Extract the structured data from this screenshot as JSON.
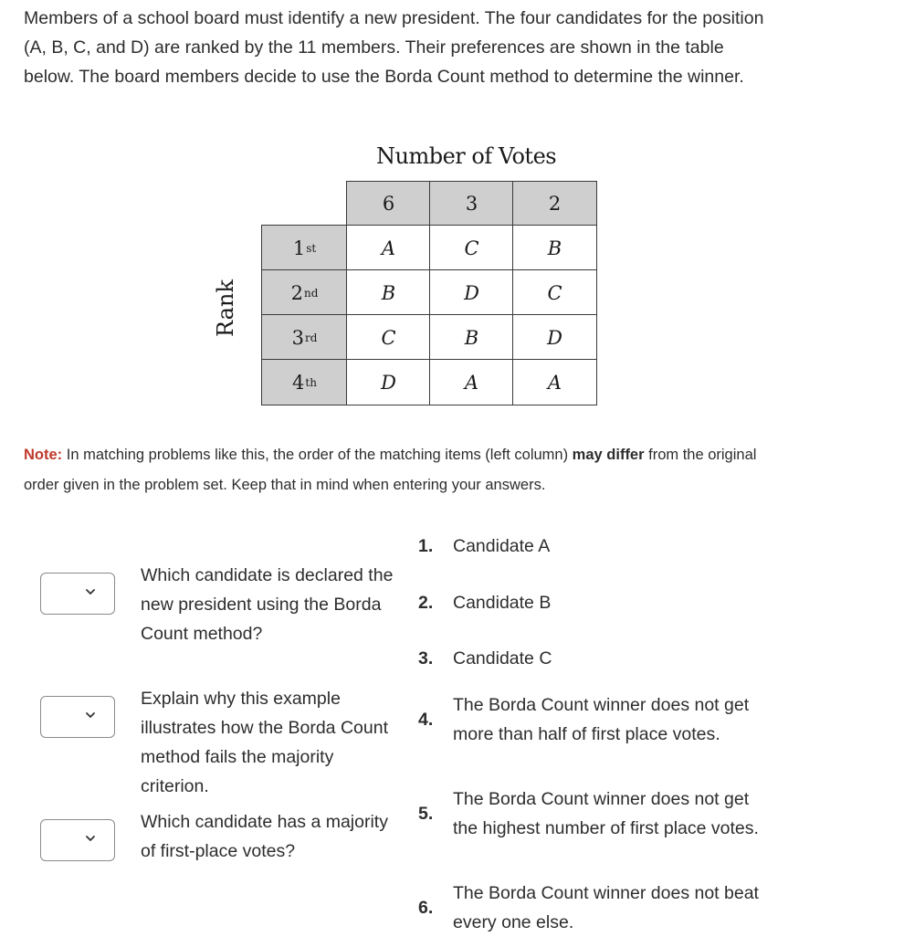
{
  "intro": "Members of a school board must identify a new president. The four candidates for the position (A, B, C, and D) are ranked by the 11 members. Their preferences are shown in the table below. The board members decide to use the Borda Count method to determine the winner.",
  "table": {
    "title": "Number of Votes",
    "rank_label": "Rank",
    "vote_counts": [
      "6",
      "3",
      "2"
    ],
    "ranks": [
      {
        "num": "1",
        "suffix": "st"
      },
      {
        "num": "2",
        "suffix": "nd"
      },
      {
        "num": "3",
        "suffix": "rd"
      },
      {
        "num": "4",
        "suffix": "th"
      }
    ],
    "rows": [
      [
        "A",
        "C",
        "B"
      ],
      [
        "B",
        "D",
        "C"
      ],
      [
        "C",
        "B",
        "D"
      ],
      [
        "D",
        "A",
        "A"
      ]
    ]
  },
  "note": {
    "label": "Note:",
    "text_before": " In matching problems like this, the order of the matching items (left column) ",
    "bold": "may differ",
    "text_after": " from the original order given in the problem set. Keep that in mind when entering your answers."
  },
  "questions": [
    {
      "text": "Which candidate is declared the new president using the Borda Count method?",
      "selected": ""
    },
    {
      "text": "Explain why this example illustrates how the Borda Count method fails the majority criterion.",
      "selected": ""
    },
    {
      "text": "Which candidate has a majority of first-place votes?",
      "selected": ""
    }
  ],
  "options": [
    {
      "num": "1.",
      "text": "Candidate A"
    },
    {
      "num": "2.",
      "text": "Candidate B"
    },
    {
      "num": "3.",
      "text": "Candidate C"
    },
    {
      "num": "4.",
      "text": "The Borda Count winner does not get more than half of first place votes."
    },
    {
      "num": "5.",
      "text": "The Borda Count winner does not get the highest number of first place votes."
    },
    {
      "num": "6.",
      "text": "The Borda Count winner does not beat every one else."
    }
  ]
}
